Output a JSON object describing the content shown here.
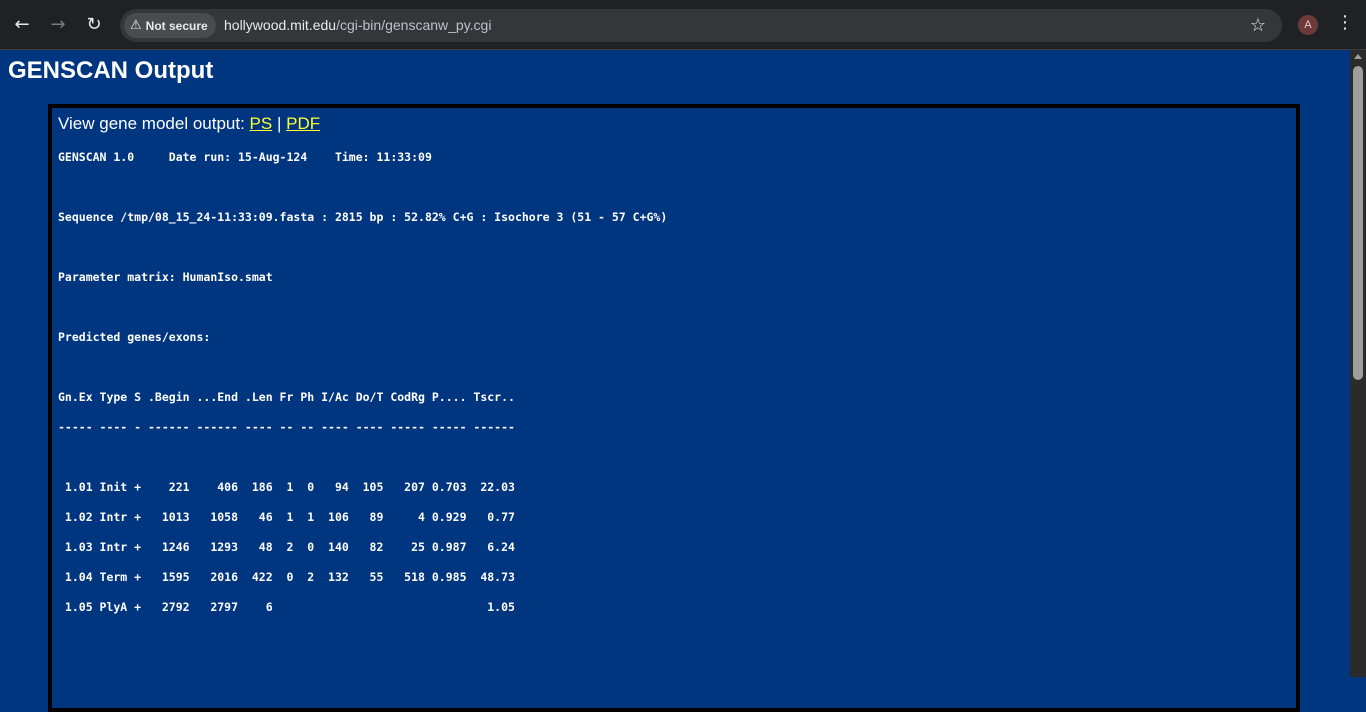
{
  "browser": {
    "back_icon": "←",
    "forward_icon": "→",
    "reload_icon": "↻",
    "security_label": "Not secure",
    "url_host": "hollywood.mit.edu",
    "url_path": "/cgi-bin/genscanw_py.cgi",
    "avatar_letter": "A",
    "star_icon": "☆",
    "menu_icon": "⋮"
  },
  "page": {
    "title": "GENSCAN Output",
    "view_prefix": "View gene model output: ",
    "ps_link": "PS",
    "separator": " | ",
    "pdf_link": "PDF"
  },
  "output": {
    "line1": "GENSCAN 1.0     Date run: 15-Aug-124    Time: 11:33:09",
    "line2": "Sequence /tmp/08_15_24-11:33:09.fasta : 2815 bp : 52.82% C+G : Isochore 3 (51 - 57 C+G%)",
    "line3": "Parameter matrix: HumanIso.smat",
    "line4": "Predicted genes/exons:",
    "header": "Gn.Ex Type S .Begin ...End .Len Fr Ph I/Ac Do/T CodRg P.... Tscr..",
    "divider": "----- ---- - ------ ------ ---- -- -- ---- ---- ----- ----- ------",
    "rows": [
      " 1.01 Init +    221    406  186  1  0   94  105   207 0.703  22.03",
      " 1.02 Intr +   1013   1058   46  1  1  106   89     4 0.929   0.77",
      " 1.03 Intr +   1246   1293   48  2  0  140   82    25 0.987   6.24",
      " 1.04 Term +   1595   2016  422  0  2  132   55   518 0.985  48.73",
      " 1.05 PlyA +   2792   2797    6                               1.05"
    ]
  }
}
